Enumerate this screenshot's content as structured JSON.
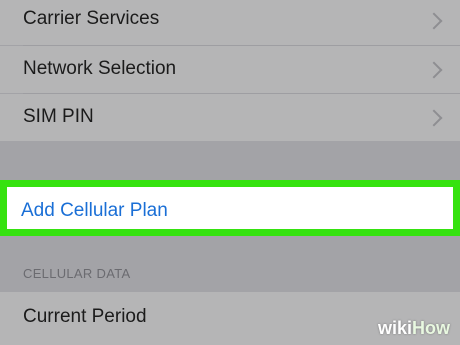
{
  "settings_rows": [
    {
      "label": "Carrier Services",
      "has_chevron": true
    },
    {
      "label": "Network Selection",
      "has_chevron": true
    },
    {
      "label": "SIM PIN",
      "has_chevron": true
    }
  ],
  "add_plan": {
    "label": "Add Cellular Plan",
    "highlight_color": "#35e20f",
    "text_color": "#1a6fd6"
  },
  "cellular_data_section": {
    "header": "CELLULAR DATA",
    "rows": [
      {
        "label": "Current Period"
      }
    ]
  },
  "watermark": {
    "wiki": "wiki",
    "how": "How"
  }
}
